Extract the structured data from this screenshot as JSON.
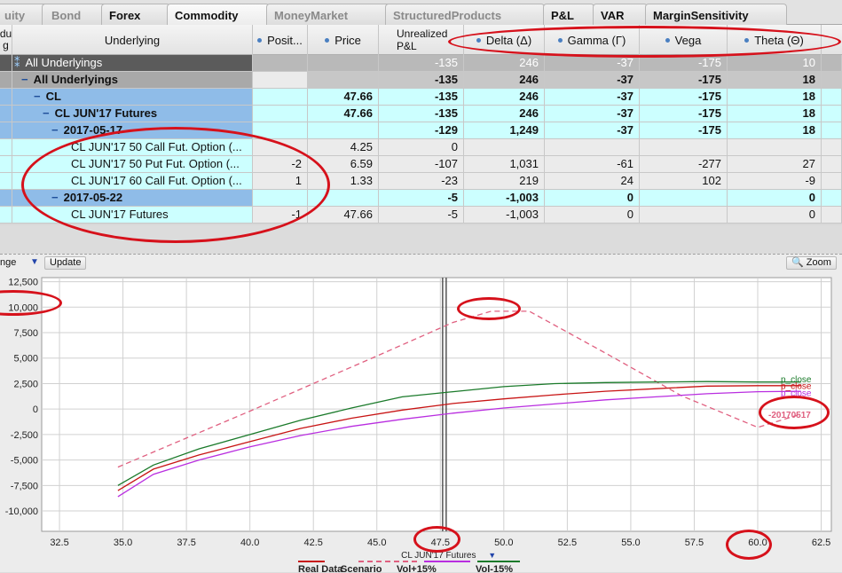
{
  "tabs": [
    "uity",
    "Bond",
    "Forex",
    "Commodity",
    "MoneyMarket",
    "StructuredProducts",
    "P&L",
    "VAR",
    "MarginSensitivity"
  ],
  "active_tab": "Commodity",
  "columns": {
    "c0a": "du",
    "c0b": "g",
    "underlying": "Underlying",
    "position": "Posit...",
    "price": "Price",
    "unrealized": "Unrealized P&L",
    "delta": "Delta (Δ)",
    "gamma": "Gamma (Γ)",
    "vega": "Vega",
    "theta": "Theta (Θ)"
  },
  "rows": [
    {
      "name": "All Underlyings",
      "prefix": "⁑",
      "indent": 0,
      "pos": "",
      "price": "",
      "pnl": "-135",
      "delta": "246",
      "gamma": "-37",
      "vega": "-175",
      "theta": "10"
    },
    {
      "name": "All Underlyings",
      "prefix": "−",
      "indent": 1,
      "pos": "",
      "price": "",
      "pnl": "-135",
      "delta": "246",
      "gamma": "-37",
      "vega": "-175",
      "theta": "18"
    },
    {
      "name": "CL",
      "prefix": "−",
      "indent": 2,
      "pos": "",
      "price": "47.66",
      "pnl": "-135",
      "delta": "246",
      "gamma": "-37",
      "vega": "-175",
      "theta": "18"
    },
    {
      "name": "CL JUN'17 Futures",
      "prefix": "−",
      "indent": 3,
      "pos": "",
      "price": "47.66",
      "pnl": "-135",
      "delta": "246",
      "gamma": "-37",
      "vega": "-175",
      "theta": "18"
    },
    {
      "name": "2017-05-17",
      "prefix": "−",
      "indent": 4,
      "pos": "",
      "price": "",
      "pnl": "-129",
      "delta": "1,249",
      "gamma": "-37",
      "vega": "-175",
      "theta": "18"
    },
    {
      "name": "CL JUN'17 50 Call Fut. Option (...",
      "prefix": "",
      "indent": 5,
      "pos": "",
      "price": "4.25",
      "pnl": "0",
      "delta": "",
      "gamma": "",
      "vega": "",
      "theta": ""
    },
    {
      "name": "CL JUN'17 50 Put Fut. Option (...",
      "prefix": "",
      "indent": 5,
      "pos": "-2",
      "price": "6.59",
      "pnl": "-107",
      "delta": "1,031",
      "gamma": "-61",
      "vega": "-277",
      "theta": "27"
    },
    {
      "name": "CL JUN'17 60 Call Fut. Option (...",
      "prefix": "",
      "indent": 5,
      "pos": "1",
      "price": "1.33",
      "pnl": "-23",
      "delta": "219",
      "gamma": "24",
      "vega": "102",
      "theta": "-9"
    },
    {
      "name": "2017-05-22",
      "prefix": "−",
      "indent": 4,
      "pos": "",
      "price": "",
      "pnl": "-5",
      "delta": "-1,003",
      "gamma": "0",
      "vega": "",
      "theta": "0"
    },
    {
      "name": "CL JUN'17 Futures",
      "prefix": "",
      "indent": 5,
      "pos": "-1",
      "price": "47.66",
      "pnl": "-5",
      "delta": "-1,003",
      "gamma": "0",
      "vega": "",
      "theta": "0"
    }
  ],
  "toolbar": {
    "range_label": "nge",
    "update_label": "Update",
    "zoom_label": "Zoom"
  },
  "chart_data": {
    "type": "line",
    "x_ticks": [
      "32.5",
      "35.0",
      "37.5",
      "40.0",
      "42.5",
      "45.0",
      "47.5",
      "50.0",
      "52.5",
      "55.0",
      "57.5",
      "60.0",
      "62.5"
    ],
    "y_ticks": [
      "12,500",
      "10,000",
      "7,500",
      "5,000",
      "2,500",
      "0",
      "-2,500",
      "-5,000",
      "-7,500",
      "-10,000"
    ],
    "xlim": [
      31.8,
      62.9
    ],
    "ylim": [
      -12000,
      12900
    ],
    "x_axis_label": "CL JUN'17 Futures",
    "current_price": 47.66,
    "series": [
      {
        "name": "Real Data",
        "color": "#c81414",
        "dashed": false,
        "x": [
          34.8,
          36.2,
          38,
          40,
          42,
          44,
          46,
          48,
          50,
          52,
          54,
          56,
          58,
          60,
          61.7
        ],
        "y": [
          -8000,
          -5900,
          -4500,
          -3200,
          -1900,
          -900,
          -100,
          550,
          1000,
          1400,
          1750,
          2000,
          2250,
          2300,
          2300
        ]
      },
      {
        "name": "Scenario",
        "color": "#e06080",
        "dashed": true,
        "x": [
          34.8,
          40,
          45,
          48,
          49.5,
          51,
          54,
          57,
          60,
          61.7
        ],
        "y": [
          -5700,
          -200,
          5200,
          8500,
          9600,
          9600,
          5500,
          1300,
          -1800,
          -500
        ]
      },
      {
        "name": "Vol+15%",
        "color": "#b92ee0",
        "dashed": false,
        "x": [
          34.8,
          36.2,
          38,
          40,
          42,
          44,
          46,
          48,
          50,
          52,
          54,
          56,
          58,
          60,
          61.7
        ],
        "y": [
          -8600,
          -6400,
          -5000,
          -3700,
          -2600,
          -1700,
          -1000,
          -400,
          100,
          500,
          900,
          1200,
          1500,
          1700,
          1750
        ]
      },
      {
        "name": "Vol-15%",
        "color": "#1a7a2a",
        "dashed": false,
        "x": [
          34.8,
          36.2,
          38,
          40,
          42,
          44,
          46,
          48,
          50,
          52,
          54,
          56,
          58,
          60,
          61.7
        ],
        "y": [
          -7500,
          -5500,
          -3900,
          -2500,
          -1100,
          100,
          1200,
          1700,
          2200,
          2500,
          2600,
          2650,
          2700,
          2650,
          2650
        ]
      }
    ],
    "line_labels": [
      "p_close",
      "p_close",
      "p_close"
    ],
    "scenario_label": "-20170517",
    "legend": [
      "Real Data",
      "Scenario",
      "Vol+15%",
      "Vol-15%"
    ]
  }
}
